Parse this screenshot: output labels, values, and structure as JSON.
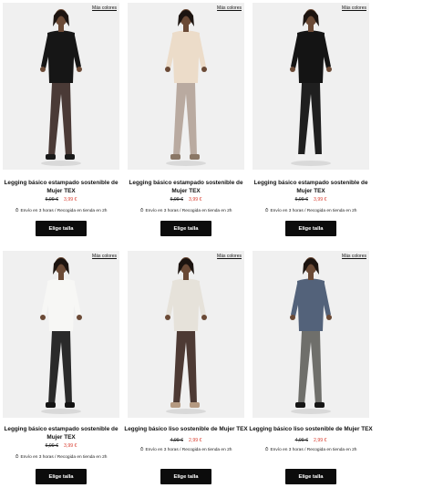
{
  "products": [
    {
      "more_colors": "Más colores",
      "title": "Legging básico estampado sostenible de Mujer TEX",
      "old_price": "6,99 €",
      "new_price": "3,99 €",
      "shipping": "Envío en 3 horas / Recogida en tienda en 2h",
      "button": "Elige talla",
      "colors": {
        "top": "#161616",
        "leg": "#4a3a36",
        "skin": "#6b4a36",
        "shoe": "#1a1a1a"
      }
    },
    {
      "more_colors": "Más colores",
      "title": "Legging básico estampado sostenible de Mujer TEX",
      "old_price": "6,99 €",
      "new_price": "3,99 €",
      "shipping": "Envío en 3 horas / Recogida en tienda en 2h",
      "button": "Elige talla",
      "colors": {
        "top": "#ecdcc9",
        "leg": "#b9aaa0",
        "skin": "#6b4a36",
        "shoe": "#8a7766"
      }
    },
    {
      "more_colors": "Más colores",
      "title": "Legging básico estampado sostenible de Mujer TEX",
      "old_price": "6,99 €",
      "new_price": "3,99 €",
      "shipping": "Envío en 3 horas / Recogida en tienda en 2h",
      "button": "Elige talla",
      "colors": {
        "top": "#141414",
        "leg": "#1f1f1f",
        "skin": "#6b4a36",
        "shoe": "#f2f2f2"
      }
    },
    {
      "more_colors": "Más colores",
      "title": "Legging básico estampado sostenible de Mujer TEX",
      "old_price": "6,99 €",
      "new_price": "3,99 €",
      "shipping": "Envío en 3 horas / Recogida en tienda en 2h",
      "button": "Elige talla",
      "colors": {
        "top": "#f7f7f5",
        "leg": "#2a2a2a",
        "skin": "#6b4a36",
        "shoe": "#141414"
      }
    },
    {
      "more_colors": "Más colores",
      "title": "Legging básico liso sostenible de Mujer TEX",
      "old_price": "4,99 €",
      "new_price": "2,99 €",
      "shipping": "Envío en 3 horas / Recogida en tienda en 2h",
      "button": "Elige talla",
      "colors": {
        "top": "#e6e2da",
        "leg": "#4d3a34",
        "skin": "#6b4a36",
        "shoe": "#b59a82"
      }
    },
    {
      "more_colors": "Más colores",
      "title": "Legging básico liso sostenible de Mujer TEX",
      "old_price": "4,99 €",
      "new_price": "2,99 €",
      "shipping": "Envío en 3 horas / Recogida en tienda en 2h",
      "button": "Elige talla",
      "colors": {
        "top": "#53627a",
        "leg": "#6f6f6b",
        "skin": "#6b4a36",
        "shoe": "#161616"
      }
    }
  ]
}
